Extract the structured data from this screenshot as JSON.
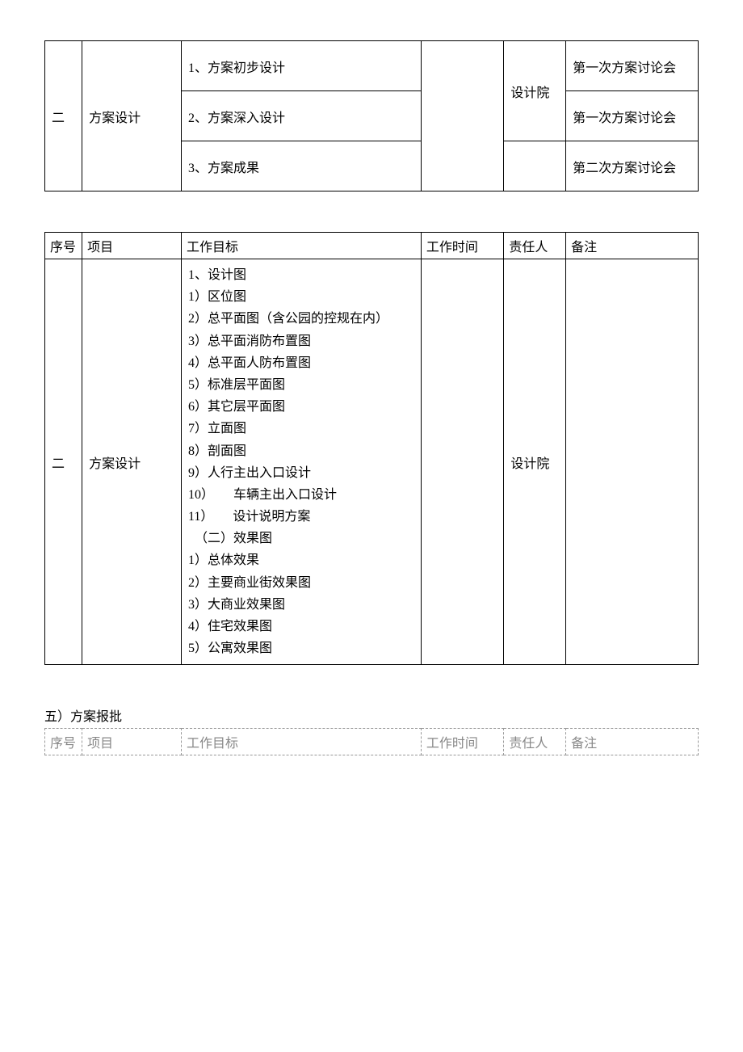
{
  "table1": {
    "row1": {
      "seq": "二",
      "project": "方案设计",
      "goal": "1、方案初步设计",
      "time": "",
      "responsible": "设计院",
      "note": "第一次方案讨论会"
    },
    "row2": {
      "goal": "2、方案深入设计",
      "note": "第一次方案讨论会"
    },
    "row3": {
      "goal": "3、方案成果",
      "note": "第二次方案讨论会"
    }
  },
  "table2": {
    "header": {
      "seq": "序号",
      "project": "项目",
      "goal": "工作目标",
      "time": "工作时间",
      "responsible": "责任人",
      "note": "备注"
    },
    "body": {
      "seq": "二",
      "project": "方案设计",
      "goal": "1、设计图\n1）区位图\n2）总平面图（含公园的控规在内）\n3）总平面消防布置图\n4）总平面人防布置图\n5）标准层平面图\n6）其它层平面图\n7）立面图\n8）剖面图\n9）人行主出入口设计\n10）　　车辆主出入口设计\n11）　　设计说明方案\n　（二）效果图\n1）总体效果\n2）主要商业街效果图\n3）大商业效果图\n4）住宅效果图\n5）公寓效果图",
      "time": "",
      "responsible": "设计院",
      "note": ""
    }
  },
  "section5_heading": "五）方案报批",
  "table3": {
    "header": {
      "seq": "序号",
      "project": "项目",
      "goal": "工作目标",
      "time": "工作时间",
      "responsible": "责任人",
      "note": "备注"
    }
  }
}
